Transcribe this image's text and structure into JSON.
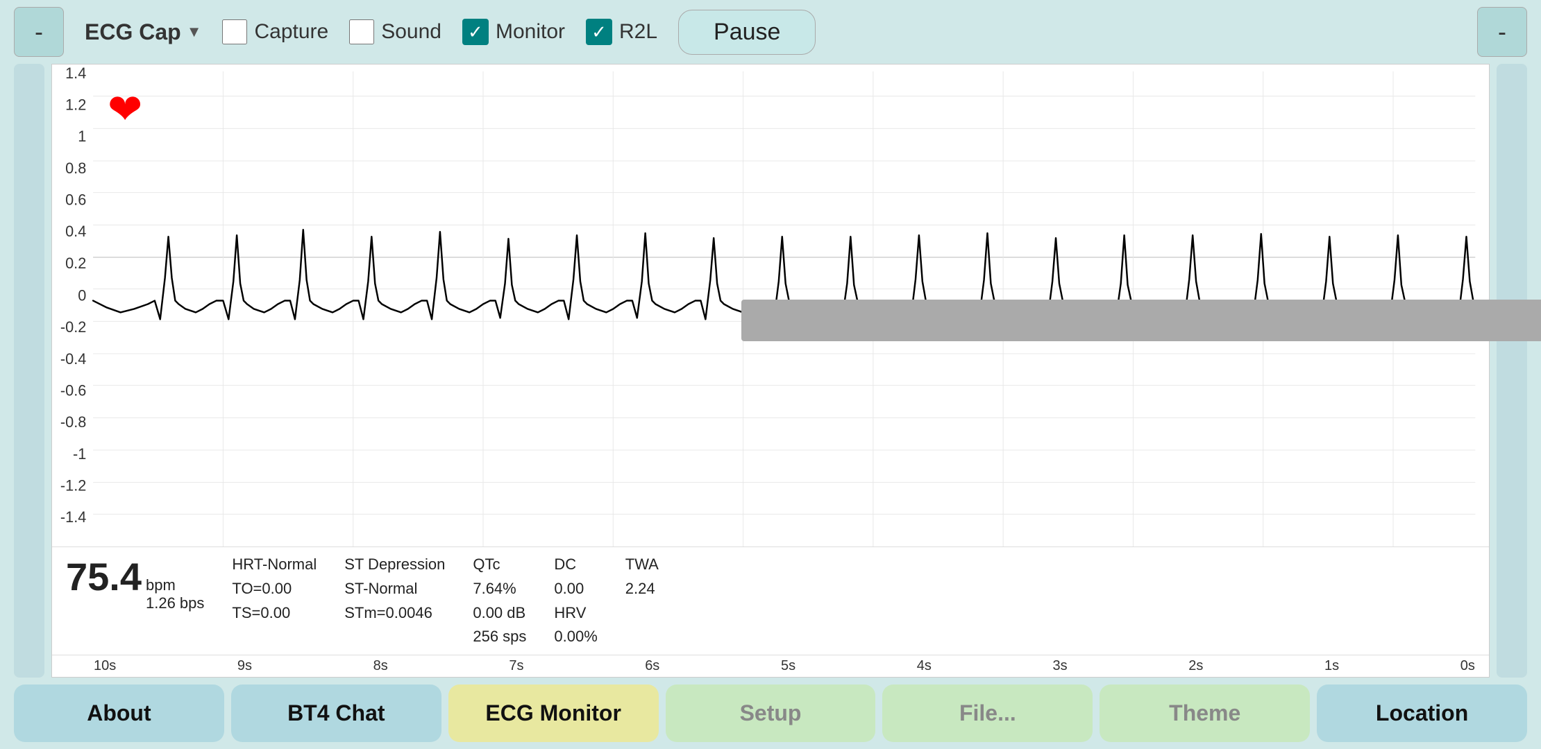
{
  "toolbar": {
    "minus_left_label": "-",
    "minus_right_label": "-",
    "app_title": "ECG Cap",
    "dropdown_arrow": "▼",
    "capture_label": "Capture",
    "sound_label": "Sound",
    "monitor_label": "Monitor",
    "r2l_label": "R2L",
    "pause_label": "Pause",
    "capture_checked": false,
    "sound_checked": false,
    "monitor_checked": true,
    "r2l_checked": true
  },
  "chart": {
    "y_axis_labels": [
      "1.4",
      "1.2",
      "1",
      "0.8",
      "0.6",
      "0.4",
      "0.2",
      "0",
      "-0.2",
      "-0.4",
      "-0.6",
      "-0.8",
      "-1",
      "-1.2",
      "-1.4"
    ],
    "x_axis_labels": [
      "10s",
      "9s",
      "8s",
      "7s",
      "6s",
      "5s",
      "4s",
      "3s",
      "2s",
      "1s",
      "0s"
    ]
  },
  "stats": {
    "bpm_value": "75.4",
    "bpm_unit": "bpm",
    "bps_value": "1.26 bps",
    "hrt_label": "HRT-Normal",
    "to_label": "TO=0.00",
    "ts_label": "TS=0.00",
    "st_depression_label": "ST Depression",
    "st_normal_label": "ST-Normal",
    "stm_label": "STm=0.0046",
    "qtc_label": "QTc",
    "qtc_value": "7.64%",
    "qtc_db": "0.00 dB",
    "qtc_sps": "256 sps",
    "dc_label": "DC",
    "dc_value": "0.00",
    "hrv_label": "HRV",
    "hrv_value": "0.00%",
    "twa_label": "TWA",
    "twa_value": "2.24"
  },
  "nav": {
    "about_label": "About",
    "bt4chat_label": "BT4 Chat",
    "ecgmonitor_label": "ECG Monitor",
    "setup_label": "Setup",
    "file_label": "File...",
    "theme_label": "Theme",
    "location_label": "Location"
  },
  "colors": {
    "teal": "#008080",
    "light_teal_bg": "#d0e8e8",
    "tab_active": "#e8e8a0",
    "tab_green": "#c8e8c0",
    "tab_blue": "#b0d8e0"
  }
}
